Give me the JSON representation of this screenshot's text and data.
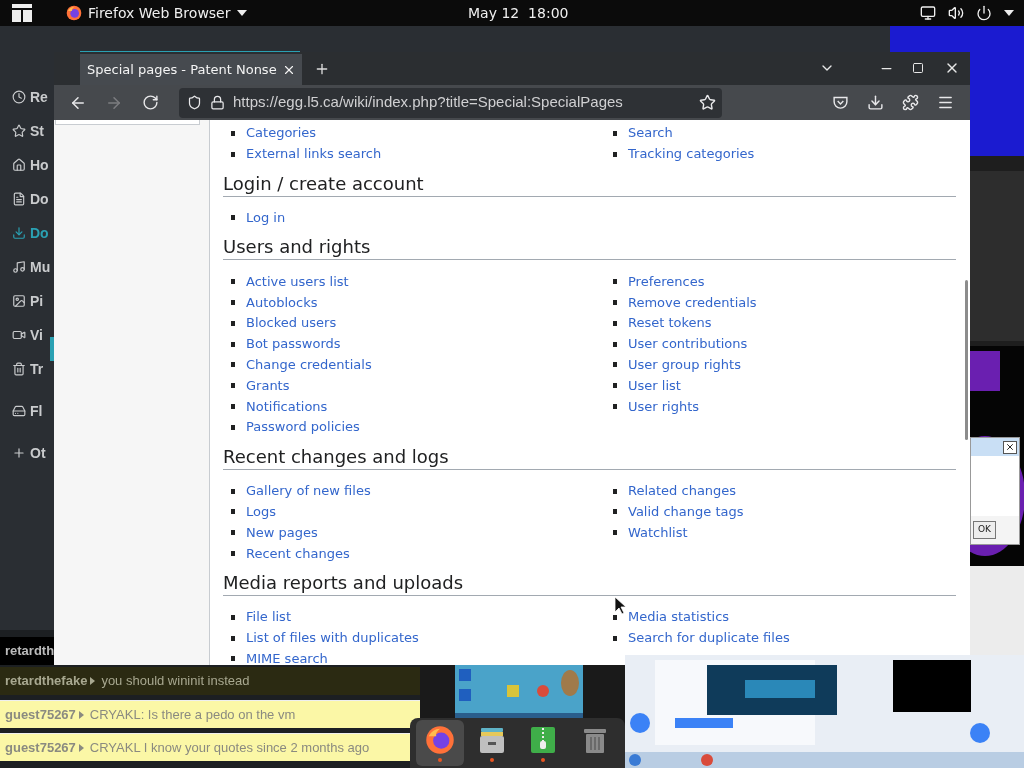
{
  "top_bar": {
    "app_name": "Firefox Web Browser",
    "clock": "May 12  18:00"
  },
  "file_manager": {
    "sidebar_groups": [
      [
        {
          "label": "Re",
          "selected": false
        },
        {
          "label": "St",
          "selected": false
        },
        {
          "label": "Ho",
          "selected": false
        },
        {
          "label": "Do",
          "selected": false
        },
        {
          "label": "Do",
          "selected": true
        },
        {
          "label": "Mu",
          "selected": false
        },
        {
          "label": "Pi",
          "selected": false
        },
        {
          "label": "Vi",
          "selected": false
        },
        {
          "label": "Tr",
          "selected": false
        }
      ],
      [
        {
          "label": "Fl",
          "selected": false
        }
      ],
      [
        {
          "label": "Ot",
          "selected": false
        }
      ]
    ]
  },
  "browser": {
    "tabs": [
      {
        "title": "Special pages - Patent Nonse",
        "selected": true
      }
    ],
    "nav": [
      {
        "kind": "back",
        "disabled": false
      },
      {
        "kind": "forward",
        "disabled": true
      },
      {
        "kind": "reload",
        "disabled": false
      }
    ],
    "url": "https://egg.l5.ca/wiki/index.php?title=Special:SpecialPages",
    "sections": [
      {
        "columns": [
          [
            "Categories",
            "External links search"
          ],
          [
            "Search",
            "Tracking categories"
          ]
        ]
      },
      {
        "heading": "Login / create account",
        "columns": [
          [
            "Log in"
          ],
          []
        ]
      },
      {
        "heading": "Users and rights",
        "columns": [
          [
            "Active users list",
            "Autoblocks",
            "Blocked users",
            "Bot passwords",
            "Change credentials",
            "Grants",
            "Notifications",
            "Password policies"
          ],
          [
            "Preferences",
            "Remove credentials",
            "Reset tokens",
            "User contributions",
            "User group rights",
            "User list",
            "User rights"
          ]
        ]
      },
      {
        "heading": "Recent changes and logs",
        "columns": [
          [
            "Gallery of new files",
            "Logs",
            "New pages",
            "Recent changes"
          ],
          [
            "Related changes",
            "Valid change tags",
            "Watchlist"
          ]
        ]
      },
      {
        "heading": "Media reports and uploads",
        "columns": [
          [
            "File list",
            "List of files with duplicates",
            "MIME search"
          ],
          [
            "Media statistics",
            "Search for duplicate files"
          ]
        ]
      }
    ]
  },
  "dialog": {
    "button": "OK"
  },
  "chat": [
    {
      "kind": "dark",
      "user": "retardth"
    },
    {
      "kind": "olive",
      "user": "retardthefake",
      "message": "you should wininit instead"
    },
    {
      "kind": "yellow",
      "user": "guest75267",
      "message": "CRYAKL: Is there a pedo on the vm"
    },
    {
      "kind": "yellow",
      "user": "guest75267",
      "message": "CRYAKL I know your quotes since 2 months ago"
    }
  ],
  "dock": [
    {
      "kind": "firefox",
      "selected": true,
      "running": true
    },
    {
      "kind": "files",
      "selected": false,
      "running": true
    },
    {
      "kind": "archive",
      "selected": false,
      "running": true
    },
    {
      "kind": "trash",
      "selected": false,
      "running": false
    }
  ]
}
